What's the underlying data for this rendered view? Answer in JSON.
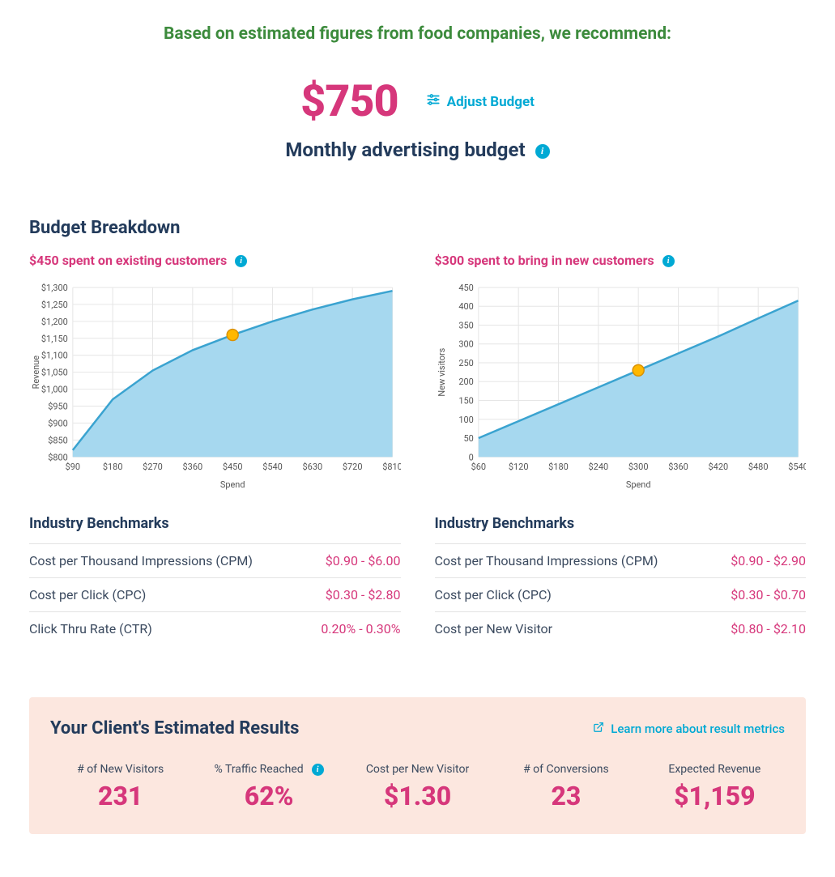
{
  "banner": "Based on estimated figures from food companies, we recommend:",
  "budget": {
    "amount": "$750",
    "adjust_label": "Adjust Budget",
    "subtitle": "Monthly advertising budget"
  },
  "breakdown_title": "Budget Breakdown",
  "left": {
    "header": "$450 spent on existing customers",
    "bench_title": "Industry Benchmarks",
    "bench": [
      {
        "label": "Cost per Thousand Impressions (CPM)",
        "value": "$0.90 - $6.00"
      },
      {
        "label": "Cost per Click (CPC)",
        "value": "$0.30 - $2.80"
      },
      {
        "label": "Click Thru Rate (CTR)",
        "value": "0.20% - 0.30%"
      }
    ]
  },
  "right": {
    "header": "$300 spent to bring in new customers",
    "bench_title": "Industry Benchmarks",
    "bench": [
      {
        "label": "Cost per Thousand Impressions (CPM)",
        "value": "$0.90 - $2.90"
      },
      {
        "label": "Cost per Click (CPC)",
        "value": "$0.30 - $0.70"
      },
      {
        "label": "Cost per New Visitor",
        "value": "$0.80 - $2.10"
      }
    ]
  },
  "results": {
    "title": "Your Client's Estimated Results",
    "learn_more": "Learn more about result metrics",
    "metrics": [
      {
        "label": "# of New Visitors",
        "value": "231"
      },
      {
        "label": "% Traffic Reached",
        "value": "62%",
        "info": true
      },
      {
        "label": "Cost per New Visitor",
        "value": "$1.30"
      },
      {
        "label": "# of Conversions",
        "value": "23"
      },
      {
        "label": "Expected Revenue",
        "value": "$1,159"
      }
    ]
  },
  "chart_data": [
    {
      "type": "area",
      "title": "",
      "xlabel": "Spend",
      "ylabel": "Revenue",
      "x_ticks": [
        "$90",
        "$180",
        "$270",
        "$360",
        "$450",
        "$540",
        "$630",
        "$720",
        "$810"
      ],
      "y_ticks": [
        "$800",
        "$850",
        "$900",
        "$950",
        "$1,000",
        "$1,050",
        "$1,100",
        "$1,150",
        "$1,200",
        "$1,250",
        "$1,300"
      ],
      "x": [
        90,
        180,
        270,
        360,
        450,
        540,
        630,
        720,
        810
      ],
      "y": [
        820,
        970,
        1055,
        1115,
        1160,
        1200,
        1235,
        1265,
        1290
      ],
      "xlim": [
        90,
        810
      ],
      "ylim": [
        800,
        1300
      ],
      "marker": {
        "x": 450,
        "y": 1160
      }
    },
    {
      "type": "area",
      "title": "",
      "xlabel": "Spend",
      "ylabel": "New visitors",
      "x_ticks": [
        "$60",
        "$120",
        "$180",
        "$240",
        "$300",
        "$360",
        "$420",
        "$480",
        "$540"
      ],
      "y_ticks": [
        "0",
        "50",
        "100",
        "150",
        "200",
        "250",
        "300",
        "350",
        "400",
        "450"
      ],
      "x": [
        60,
        120,
        180,
        240,
        300,
        360,
        420,
        480,
        540
      ],
      "y": [
        50,
        95,
        140,
        185,
        230,
        275,
        320,
        368,
        415
      ],
      "xlim": [
        60,
        540
      ],
      "ylim": [
        0,
        450
      ],
      "marker": {
        "x": 300,
        "y": 230
      }
    }
  ]
}
